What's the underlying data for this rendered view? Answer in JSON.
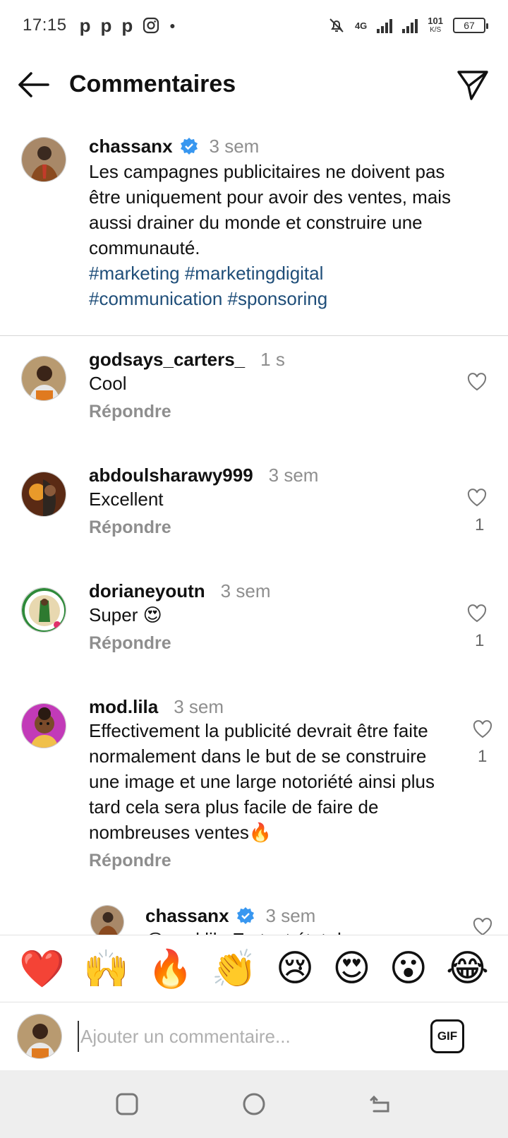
{
  "status_bar": {
    "time": "17:15",
    "app_icons": [
      "p",
      "p",
      "p"
    ],
    "network": "4G",
    "speed": "101",
    "speed_unit": "K/S",
    "battery": "67"
  },
  "header": {
    "title": "Commentaires",
    "back_icon": "arrow-left-icon",
    "share_icon": "paper-plane-icon"
  },
  "caption": {
    "username": "chassanx",
    "verified": true,
    "time": "3 sem",
    "text": "Les campagnes publicitaires ne doivent pas être uniquement pour avoir des ventes, mais aussi drainer du monde et construire une communauté.",
    "hashtags": "#marketing #marketingdigital #communication #sponsoring"
  },
  "comments": [
    {
      "username": "godsays_carters_",
      "time": "1 s",
      "text": "Cool",
      "reply": "Répondre",
      "likes": ""
    },
    {
      "username": "abdoulsharawy999",
      "time": "3 sem",
      "text": "Excellent",
      "reply": "Répondre",
      "likes": "1"
    },
    {
      "username": "dorianeyoutn",
      "time": "3 sem",
      "text": "Super 😍",
      "reply": "Répondre",
      "likes": "1"
    },
    {
      "username": "mod.lila",
      "time": "3 sem",
      "text": "Effectivement la publicité devrait être faite normalement dans le but de se construire une image et une large notoriété ainsi plus tard cela sera plus facile de faire de nombreuses ventes🔥",
      "reply": "Répondre",
      "likes": "1"
    }
  ],
  "reply_preview": {
    "username": "chassanx",
    "time": "3 sem",
    "text": "@mod.lila En tout état de cause"
  },
  "emoji_bar": [
    "❤️",
    "🙌",
    "🔥",
    "👏",
    "😢",
    "😍",
    "😮",
    "😂"
  ],
  "composer": {
    "placeholder": "Ajouter un commentaire...",
    "gif_label": "GIF"
  },
  "colors": {
    "hashtag": "#1f4e79",
    "verified": "#3897f0",
    "muted": "#8e8e8e"
  }
}
